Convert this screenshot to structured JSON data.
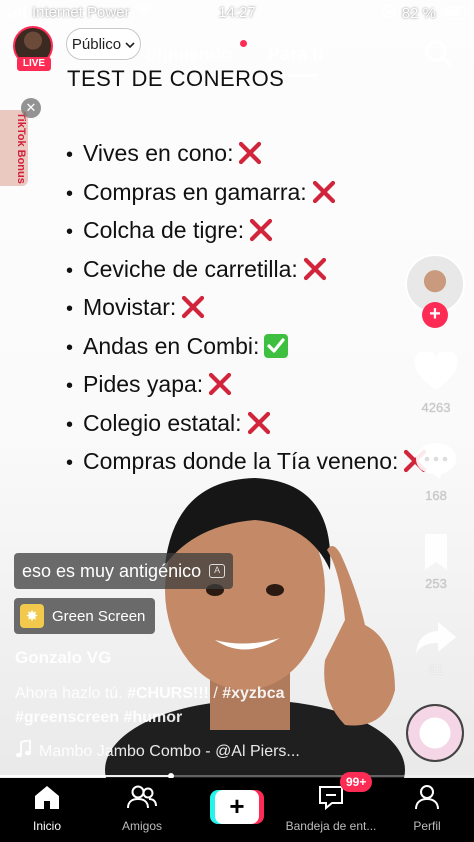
{
  "status_bar": {
    "carrier": "Internet Power",
    "time": "14:27",
    "battery": "82 %"
  },
  "top_nav": {
    "live_badge": "LIVE",
    "public_label": "Público",
    "tab_following": "Siguiendo",
    "tab_for_you": "Para ti"
  },
  "bonus_tag": "TikTok Bonus",
  "video": {
    "title": "TEST DE CONEROS",
    "items": [
      {
        "text": "Vives en cono:",
        "mark": "cross"
      },
      {
        "text": "Compras en gamarra:",
        "mark": "cross"
      },
      {
        "text": "Colcha de tigre:",
        "mark": "cross"
      },
      {
        "text": "Ceviche de carretilla:",
        "mark": "cross"
      },
      {
        "text": "Movistar:",
        "mark": "cross"
      },
      {
        "text": "Andas en Combi:",
        "mark": "check"
      },
      {
        "text": "Pides yapa:",
        "mark": "cross"
      },
      {
        "text": "Colegio estatal:",
        "mark": "cross"
      },
      {
        "text": "Compras donde la Tía veneno:",
        "mark": "cross"
      }
    ]
  },
  "right_rail": {
    "likes": "4263",
    "comments": "168",
    "bookmarks": "253",
    "shares": "61"
  },
  "caption": {
    "subtitle": "eso es muy antigénico",
    "cc_label": "A",
    "effect": "Green Screen",
    "username": "Gonzalo VG",
    "description_prefix": "Ahora hazlo tú.",
    "tag_1": "#CHURS!!!",
    "separator": "/",
    "tag_2": "#xyzbca",
    "tag_3": "#greenscreen",
    "tag_4": "#humor",
    "music": "Mambo Jambo Combo - @Al Piers..."
  },
  "playback": {
    "progress_fraction": 0.36
  },
  "bottom_nav": {
    "home": "Inicio",
    "friends": "Amigos",
    "inbox": "Bandeja de ent...",
    "inbox_badge": "99+",
    "profile": "Perfil"
  },
  "colors": {
    "accent": "#fe2c55",
    "cyan": "#25f4ee",
    "cross": "#d0253a",
    "check": "#3fbf3f"
  }
}
